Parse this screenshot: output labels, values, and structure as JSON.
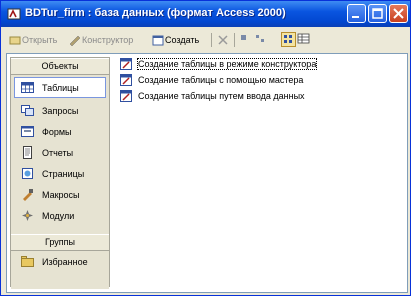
{
  "window": {
    "title": "BDTur_firm : база данных (формат Access 2000)"
  },
  "toolbar": {
    "open_label": "Открыть",
    "design_label": "Конструктор",
    "create_label": "Создать"
  },
  "sidebar": {
    "objects_header": "Объекты",
    "items": [
      {
        "label": "Таблицы",
        "icon": "table-icon"
      },
      {
        "label": "Запросы",
        "icon": "query-icon"
      },
      {
        "label": "Формы",
        "icon": "form-icon"
      },
      {
        "label": "Отчеты",
        "icon": "report-icon"
      },
      {
        "label": "Страницы",
        "icon": "page-icon"
      },
      {
        "label": "Макросы",
        "icon": "macro-icon"
      },
      {
        "label": "Модули",
        "icon": "module-icon"
      }
    ],
    "groups_header": "Группы",
    "favorites_label": "Избранное"
  },
  "list": {
    "items": [
      "Создание таблицы в режиме конструктора",
      "Создание таблицы с помощью мастера",
      "Создание таблицы путем ввода данных"
    ]
  },
  "colors": {
    "titlebar": "#0A55E0",
    "selection_border": "#7A96DF"
  }
}
